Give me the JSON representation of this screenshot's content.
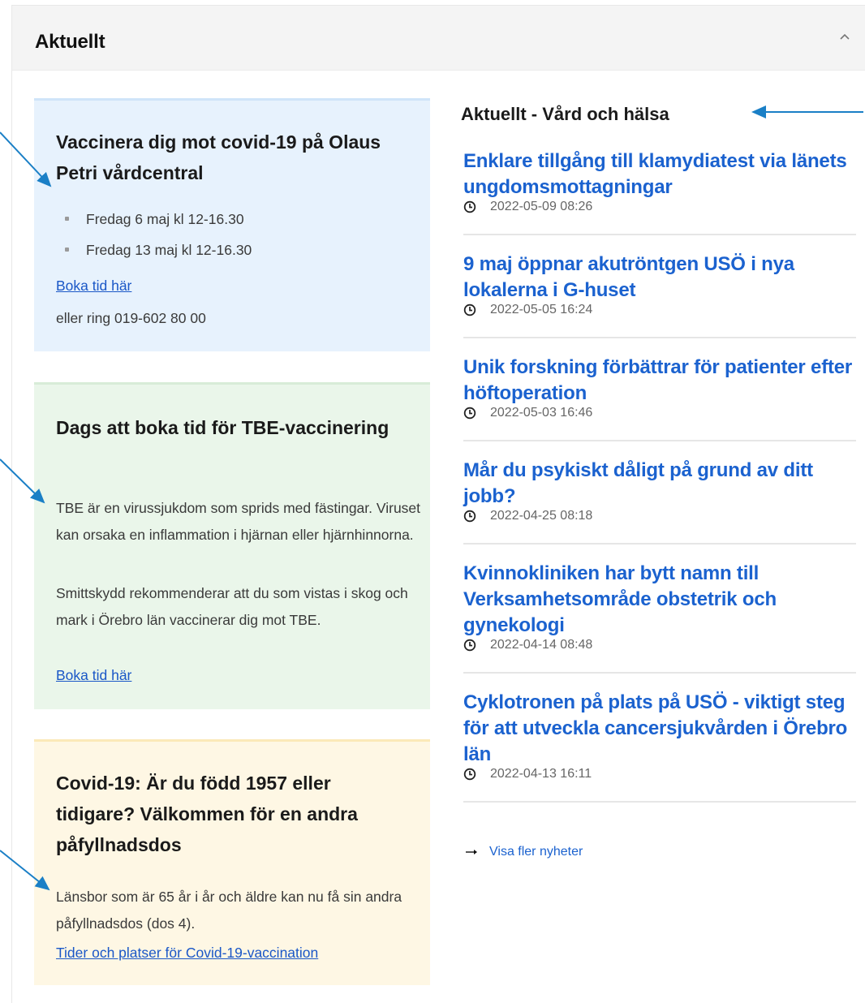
{
  "panel": {
    "title": "Aktuellt"
  },
  "cards": [
    {
      "title": "Vaccinera dig mot covid-19 på Olaus Petri vårdcentral",
      "items": [
        "Fredag 6 maj kl 12-16.30",
        "Fredag 13 maj kl 12-16.30"
      ],
      "link": "Boka tid här",
      "note": "eller ring 019-602 80 00"
    },
    {
      "title": "Dags att boka tid för TBE-vaccinering",
      "paragraphs": [
        "TBE är en virussjukdom som sprids med fästingar. Viruset kan orsaka en inflammation i hjärnan eller hjärnhinnorna.",
        "Smittskydd rekommenderar att du som vistas i skog och mark i Örebro län vaccinerar dig mot TBE."
      ],
      "link": "Boka tid här"
    },
    {
      "title": "Covid-19: Är du född 1957 eller tidigare? Välkommen för en andra påfyllnadsdos",
      "paragraph": "Länsbor som är 65 år i år och äldre kan nu få sin andra påfyllnadsdos (dos 4).",
      "link": "Tider och platser för Covid-19-vaccination"
    }
  ],
  "news": {
    "heading": "Aktuellt - Vård och hälsa",
    "items": [
      {
        "title": "Enklare tillgång till klamydiatest via länets ungdomsmottagningar",
        "date": "2022-05-09 08:26"
      },
      {
        "title": "9 maj öppnar akutröntgen USÖ i nya lokalerna i G-huset",
        "date": "2022-05-05 16:24"
      },
      {
        "title": "Unik forskning förbättrar för patienter efter höftoperation",
        "date": "2022-05-03 16:46"
      },
      {
        "title": "Mår du psykiskt dåligt på grund av ditt jobb?",
        "date": "2022-04-25 08:18"
      },
      {
        "title": "Kvinnokliniken har bytt namn till Verksamhetsområde obstetrik och gynekologi",
        "date": "2022-04-14 08:48"
      },
      {
        "title": "Cyklotronen på plats på USÖ - viktigt steg för att utveckla cancersjukvården i Örebro län",
        "date": "2022-04-13 16:11"
      }
    ],
    "more_link": "Visa fler nyheter"
  },
  "icons": {
    "collapse": "chevron-up-icon",
    "clock": "clock-icon",
    "arrow": "arrow-right-icon"
  },
  "colors": {
    "link": "#1b62cf",
    "annotation_arrow": "#1a7fc6",
    "card_blue": "#e7f2fd",
    "card_green": "#eaf6ea",
    "card_yellow": "#fef7e4"
  }
}
